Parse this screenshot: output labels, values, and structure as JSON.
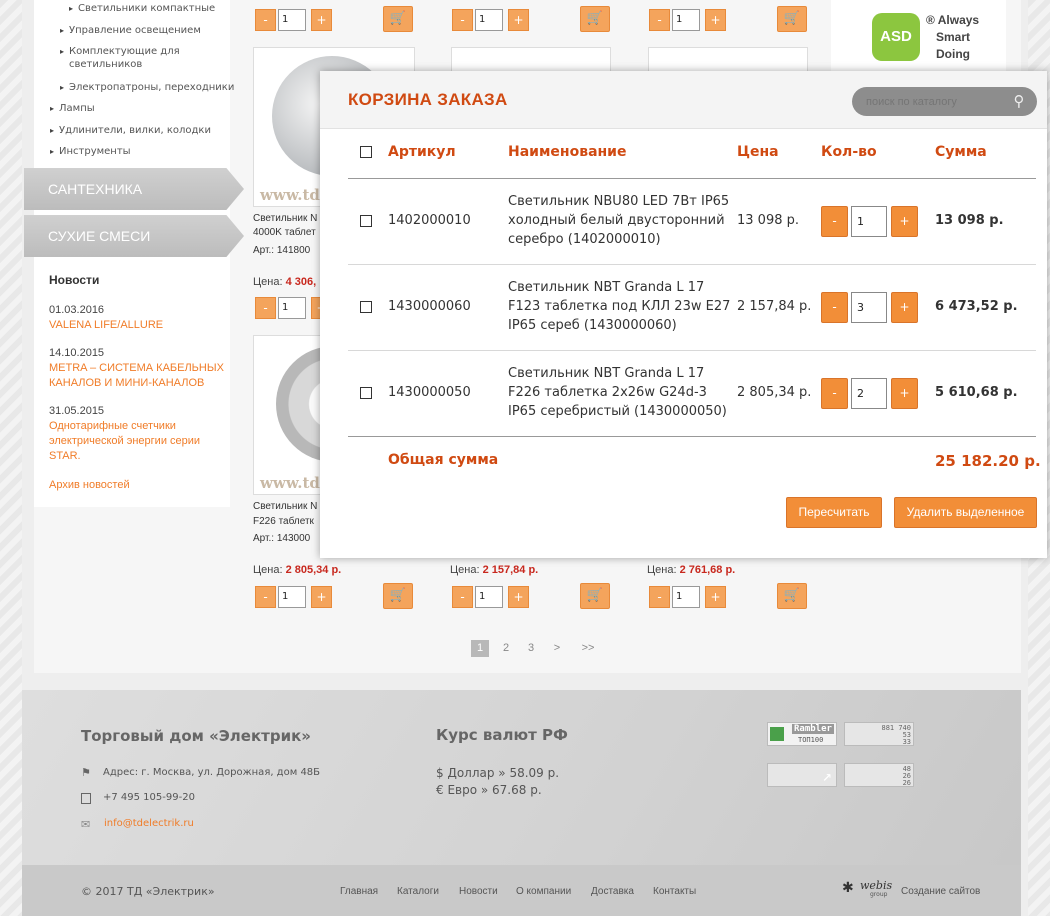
{
  "sidebar": {
    "categories": [
      "Светильники компактные",
      "Управление освещением",
      "Комплектующие для светильников",
      "Электропатроны, переходники",
      "Лампы",
      "Удлинители, вилки, колодки",
      "Инструменты"
    ],
    "categories_line2": [
      "",
      "",
      "светильников",
      "",
      "",
      "",
      ""
    ],
    "tabs": [
      "Сантехника",
      "Сухие смеси"
    ],
    "news_heading": "Новости",
    "news": [
      {
        "date": "01.03.2016",
        "title": "VALENA LIFE/ALLURE"
      },
      {
        "date": "14.10.2015",
        "title": "METRA – СИСТЕМА КАБЕЛЬНЫХ КАНАЛОВ И МИНИ-КАНАЛОВ"
      },
      {
        "date": "31.05.2015",
        "title": "Однотарифные счетчики электрической энергии серии STAR."
      }
    ],
    "archive": "Архив новостей"
  },
  "catalog": {
    "watermark": "www.td",
    "product_lines": [
      {
        "l1": "Светильник N",
        "l2": "4000K таблет",
        "l3": "Арт.: 141800"
      },
      {
        "l1": "Светильник N",
        "l2": "F226 таблетк",
        "l3": "Арт.: 143000"
      }
    ],
    "price_label": "Цена:",
    "mid_price": "4 306,",
    "bottom_prices": [
      "2 805,34 р.",
      "2 157,84 р.",
      "2 761,68 р."
    ],
    "qty": "1",
    "minus": "-",
    "plus": "+",
    "pages": [
      "1",
      "2",
      "3",
      ">",
      ">>"
    ]
  },
  "brand": {
    "logo": "ASD",
    "slogan_1": "® Always",
    "slogan_2": "Smart",
    "slogan_3": "Doing"
  },
  "cart": {
    "title": "КОРЗИНА ЗАКАЗА",
    "search_placeholder": "поиск по каталогу",
    "headers": {
      "article": "Артикул",
      "name": "Наименование",
      "price": "Цена",
      "qty": "Кол-во",
      "sum": "Сумма"
    },
    "rows": [
      {
        "article": "1402000010",
        "name_1": "Светильник NBU80 LED 7Вт IP65",
        "name_2": "холодный белый двусторонний",
        "name_3": "серебро (1402000010)",
        "price": "13 098 р.",
        "qty": "1",
        "sum": "13 098 р."
      },
      {
        "article": "1430000060",
        "name_1": "Светильник NBT Granda L 17",
        "name_2": "F123 таблетка под КЛЛ 23w E27",
        "name_3": "IP65 сереб (1430000060)",
        "price": "2 157,84 р.",
        "qty": "3",
        "sum": "6 473,52 р."
      },
      {
        "article": "1430000050",
        "name_1": "Светильник NBT Granda L 17",
        "name_2": "F226 таблетка 2x26w G24d-3",
        "name_3": "IP65 серебристый (1430000050)",
        "price": "2 805,34 р.",
        "qty": "2",
        "sum": "5 610,68 р."
      }
    ],
    "total_label": "Общая сумма",
    "total_value": "25 182.20 р.",
    "recalc": "Пересчитать",
    "delete_selected": "Удалить выделенное"
  },
  "footer": {
    "company": "Торговый дом «Электрик»",
    "address": "Адрес: г. Москва, ул. Дорожная, дом 48Б",
    "phone": "+7 495 105-99-20",
    "email": "info@tdelectrik.ru",
    "rates_title": "Курс валют РФ",
    "usd": "$ Доллар » 58.09 р.",
    "eur": "€ Евро » 67.68 р.",
    "rambler": "Rambler",
    "rambler_sub": "ТОП100",
    "counter_1": [
      "881 740",
      "53",
      "33"
    ],
    "counter_3": [
      "48",
      "26",
      "26"
    ],
    "copyright": "© 2017 ТД «Электрик»",
    "nav": [
      "Главная",
      "Каталоги",
      "Новости",
      "О компании",
      "Доставка",
      "Контакты"
    ],
    "webis": "webis",
    "webis_sub": "group",
    "create": "Создание сайтов"
  }
}
